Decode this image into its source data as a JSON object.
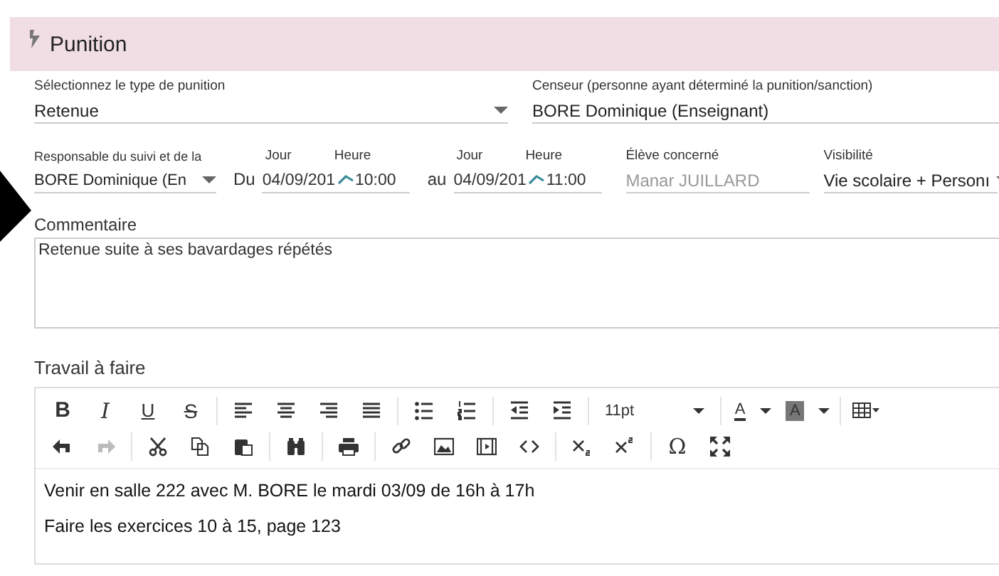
{
  "header": {
    "title": "Punition"
  },
  "type_field": {
    "label": "Sélectionnez le type de punition",
    "value": "Retenue"
  },
  "censeur_field": {
    "label": "Censeur (personne ayant déterminé la punition/sanction)",
    "value": "BORE Dominique (Enseignant)"
  },
  "responsable_field": {
    "label": "Responsable du suivi et de la",
    "value": "BORE Dominique (En"
  },
  "periods": [
    {
      "prefix": "Du",
      "day_label": "Jour",
      "time_label": "Heure",
      "date": "04/09/201",
      "time": "10:00"
    },
    {
      "prefix": "au",
      "day_label": "Jour",
      "time_label": "Heure",
      "date": "04/09/201",
      "time": "11:00"
    }
  ],
  "eleve_field": {
    "label": "Élève concerné",
    "value": "Manar JUILLARD",
    "disabled": true
  },
  "visibilite_field": {
    "label": "Visibilité",
    "value": "Vie scolaire + Personı"
  },
  "commentaire": {
    "label": "Commentaire",
    "value": "Retenue suite à ses bavardages répétés"
  },
  "travail": {
    "label": "Travail à faire",
    "toolbar": [
      [
        {
          "kind": "bold",
          "label": "B"
        },
        {
          "kind": "italic",
          "label": "I"
        },
        {
          "kind": "underline",
          "label": "U"
        },
        {
          "kind": "strike",
          "label": "S"
        },
        {
          "kind": "sep"
        },
        {
          "kind": "align-left"
        },
        {
          "kind": "align-center"
        },
        {
          "kind": "align-right"
        },
        {
          "kind": "justify"
        },
        {
          "kind": "sep"
        },
        {
          "kind": "bullets"
        },
        {
          "kind": "numbers"
        },
        {
          "kind": "sep"
        },
        {
          "kind": "outdent"
        },
        {
          "kind": "indent"
        },
        {
          "kind": "sep"
        },
        {
          "kind": "size",
          "label": "11pt"
        },
        {
          "kind": "sep"
        },
        {
          "kind": "fore-color",
          "label": "A"
        },
        {
          "kind": "back-color",
          "label": "A"
        },
        {
          "kind": "sep"
        },
        {
          "kind": "table"
        }
      ],
      [
        {
          "kind": "undo",
          "disabled": false
        },
        {
          "kind": "redo",
          "disabled": true
        },
        {
          "kind": "sep"
        },
        {
          "kind": "cut"
        },
        {
          "kind": "copy"
        },
        {
          "kind": "paste"
        },
        {
          "kind": "sep"
        },
        {
          "kind": "find"
        },
        {
          "kind": "sep"
        },
        {
          "kind": "print"
        },
        {
          "kind": "sep"
        },
        {
          "kind": "link"
        },
        {
          "kind": "image"
        },
        {
          "kind": "media"
        },
        {
          "kind": "code"
        },
        {
          "kind": "sep"
        },
        {
          "kind": "subscript"
        },
        {
          "kind": "superscript"
        },
        {
          "kind": "sep"
        },
        {
          "kind": "char",
          "label": "Ω"
        },
        {
          "kind": "fullscreen"
        }
      ]
    ],
    "paragraphs": [
      "Venir en salle 222 avec M. BORE le mardi 03/09 de 16h à 17h",
      "Faire les exercices 10 à 15, page 123"
    ]
  }
}
